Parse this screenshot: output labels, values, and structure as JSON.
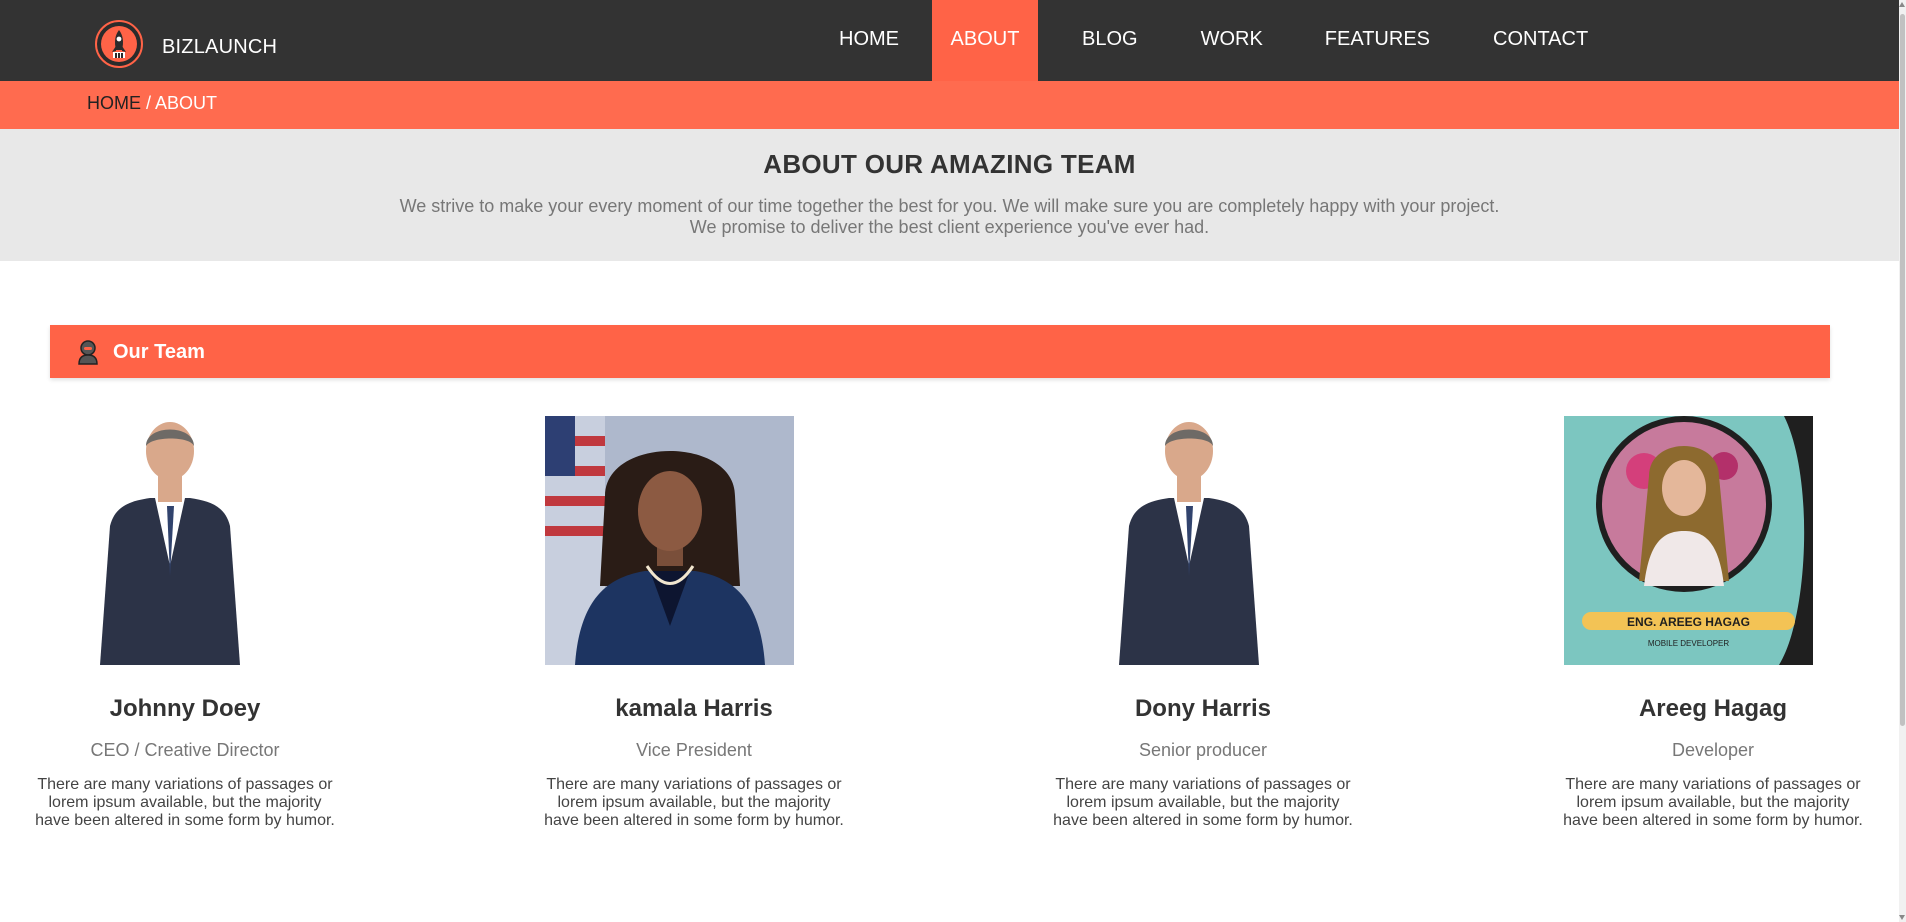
{
  "brand": {
    "name": "BIZLAUNCH",
    "logo_icon": "rocket-icon"
  },
  "nav": {
    "items": [
      {
        "label": "HOME",
        "active": false
      },
      {
        "label": "ABOUT",
        "active": true
      },
      {
        "label": "BLOG",
        "active": false
      },
      {
        "label": "WORK",
        "active": false
      },
      {
        "label": "FEATURES",
        "active": false
      },
      {
        "label": "CONTACT",
        "active": false
      }
    ]
  },
  "breadcrumb": {
    "home": "HOME",
    "separator": " / ",
    "current": "ABOUT"
  },
  "intro": {
    "title": "ABOUT OUR AMAZING TEAM",
    "line1": "We strive to make your every moment of our time together the best for you. We will make sure you are completely happy with your project.",
    "line2": "We promise to deliver the best client experience you've ever had."
  },
  "team_section": {
    "title": "Our Team",
    "icon": "person-icon"
  },
  "team": [
    {
      "name": "Johnny Doey",
      "role": "CEO / Creative Director",
      "bio": "There are many variations of passages or lorem ipsum available, but the majority have been altered in some form by humor."
    },
    {
      "name": "kamala Harris",
      "role": "Vice President",
      "bio": "There are many variations of passages or lorem ipsum available, but the majority have been altered in some form by humor."
    },
    {
      "name": "Dony Harris",
      "role": "Senior producer",
      "bio": "There are many variations of passages or lorem ipsum available, but the majority have been altered in some form by humor."
    },
    {
      "name": "Areeg Hagag",
      "role": "Developer",
      "bio": "There are many variations of passages or lorem ipsum available, but the majority have been altered in some form by humor.",
      "photo_caption": "ENG. AREEG HAGAG",
      "photo_subcaption": "MOBILE DEVELOPER"
    }
  ],
  "colors": {
    "accent": "#ff6347",
    "nav_bg": "#333333",
    "intro_bg": "#e8e8e8"
  }
}
